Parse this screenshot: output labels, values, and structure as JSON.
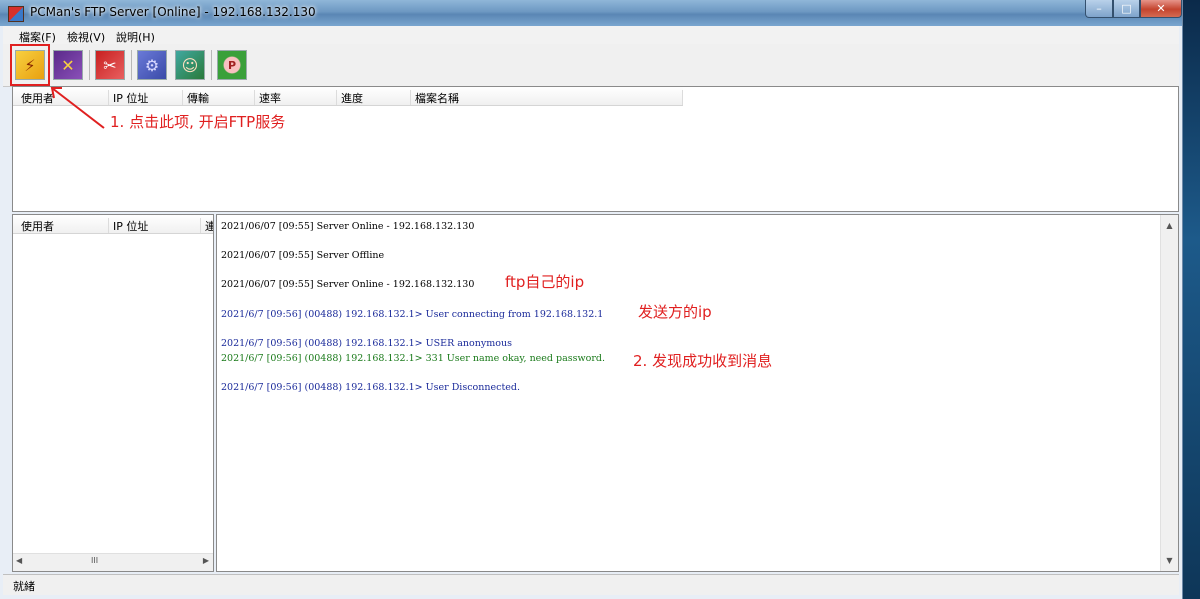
{
  "window": {
    "title": "PCMan's FTP Server [Online] - 192.168.132.130",
    "minimize_glyph": "–",
    "maximize_glyph": "□",
    "close_glyph": "✕"
  },
  "menu": [
    "檔案(F)",
    "檢視(V)",
    "說明(H)"
  ],
  "toolbar": {
    "buttons": [
      {
        "icon": "lightning-start-icon",
        "glyph": "⚡"
      },
      {
        "icon": "stop-x-icon",
        "glyph": "✕"
      },
      {
        "icon": "kick-user-icon",
        "glyph": "✂"
      },
      {
        "icon": "gear-settings-icon",
        "glyph": "⚙"
      },
      {
        "icon": "user-manager-icon",
        "glyph": "☺"
      },
      {
        "icon": "pcman-about-icon",
        "glyph": "P"
      }
    ]
  },
  "transfers_table": {
    "columns": [
      "使用者",
      "IP 位址",
      "傳輸",
      "速率",
      "進度",
      "檔案名稱"
    ]
  },
  "users_table": {
    "columns": [
      "使用者",
      "IP 位址",
      "連"
    ]
  },
  "log": [
    {
      "text": "2021/06/07 [09:55] Server Online -  192.168.132.130",
      "color": "#000000"
    },
    {
      "text": "2021/06/07 [09:55] Server Offline",
      "color": "#000000"
    },
    {
      "text": "2021/06/07 [09:55] Server Online -  192.168.132.130",
      "color": "#000000"
    },
    {
      "text": "2021/6/7 [09:56] (00488) 192.168.132.1> User connecting from 192.168.132.1",
      "color": "#1a2a9a"
    },
    {
      "text": "2021/6/7 [09:56] (00488) 192.168.132.1> USER anonymous",
      "color": "#1a2a9a"
    },
    {
      "text": "2021/6/7 [09:56] (00488) 192.168.132.1> 331 User name okay, need password.",
      "color": "#1a7a1a"
    },
    {
      "text": "2021/6/7 [09:56] (00488) 192.168.132.1> User Disconnected.",
      "color": "#1a2a9a"
    }
  ],
  "annotations": {
    "step1": "1. 点击此项, 开启FTP服务",
    "ftp_ip": "ftp自己的ip",
    "sender_ip": "发送方的ip",
    "step2": "2. 发现成功收到消息",
    "color": "#e02020"
  },
  "scroll": {
    "up": "▲",
    "down": "▼",
    "left": "◀",
    "right": "▶",
    "thumb": "III"
  },
  "status": "就緒"
}
